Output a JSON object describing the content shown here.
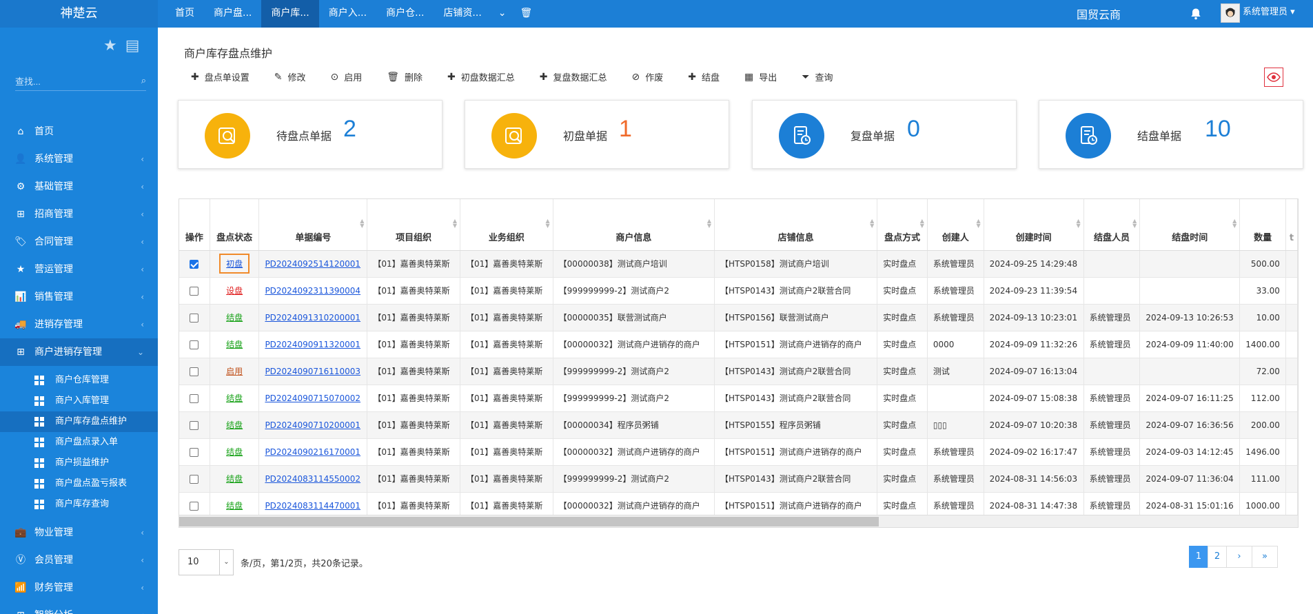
{
  "app": {
    "brand": "神楚云",
    "company": "国贸云商",
    "user": "系统管理员"
  },
  "topnav": [
    {
      "label": "首页",
      "active": false
    },
    {
      "label": "商户盘...",
      "active": false
    },
    {
      "label": "商户库...",
      "active": true
    },
    {
      "label": "商户入...",
      "active": false
    },
    {
      "label": "商户仓...",
      "active": false
    },
    {
      "label": "店铺资...",
      "active": false
    }
  ],
  "sidebar": {
    "search_placeholder": "查找...",
    "menu": [
      {
        "label": "首页",
        "icon": "home-icon",
        "glyph": "⌂",
        "chevron": ""
      },
      {
        "label": "系统管理",
        "icon": "user-icon",
        "glyph": "👤",
        "chevron": "‹"
      },
      {
        "label": "基础管理",
        "icon": "gear-icon",
        "glyph": "⚙",
        "chevron": "‹"
      },
      {
        "label": "招商管理",
        "icon": "windows-icon",
        "glyph": "⊞",
        "chevron": "‹"
      },
      {
        "label": "合同管理",
        "icon": "tag-icon",
        "glyph": "🏷",
        "chevron": "‹"
      },
      {
        "label": "营运管理",
        "icon": "star-icon",
        "glyph": "★",
        "chevron": "‹"
      },
      {
        "label": "销售管理",
        "icon": "bar-chart-icon",
        "glyph": "📊",
        "chevron": "‹"
      },
      {
        "label": "进销存管理",
        "icon": "truck-icon",
        "glyph": "🚚",
        "chevron": "‹"
      },
      {
        "label": "商户进销存管理",
        "icon": "windows-icon",
        "glyph": "⊞",
        "chevron": "⌄"
      }
    ],
    "submenu": [
      {
        "label": "商户仓库管理",
        "active": false
      },
      {
        "label": "商户入库管理",
        "active": false
      },
      {
        "label": "商户库存盘点维护",
        "active": true
      },
      {
        "label": "商户盘点录入单",
        "active": false
      },
      {
        "label": "商户损益维护",
        "active": false
      },
      {
        "label": "商户盘点盈亏报表",
        "active": false
      },
      {
        "label": "商户库存查询",
        "active": false
      }
    ],
    "menu_after": [
      {
        "label": "物业管理",
        "icon": "briefcase-icon",
        "glyph": "💼",
        "chevron": "‹"
      },
      {
        "label": "会员管理",
        "icon": "vip-icon",
        "glyph": "Ⓥ",
        "chevron": "‹"
      },
      {
        "label": "财务管理",
        "icon": "signal-icon",
        "glyph": "📶",
        "chevron": "‹"
      },
      {
        "label": "智能分析",
        "icon": "windows-icon",
        "glyph": "⊞",
        "chevron": "‹"
      }
    ]
  },
  "page": {
    "title": "商户库存盘点维护"
  },
  "toolbar": [
    {
      "label": "盘点单设置",
      "glyph": "✚",
      "icon": "plus-icon"
    },
    {
      "label": "修改",
      "glyph": "✎",
      "icon": "edit-icon"
    },
    {
      "label": "启用",
      "glyph": "⊙",
      "icon": "check-circle-icon"
    },
    {
      "label": "删除",
      "glyph": "🗑",
      "icon": "trash-icon"
    },
    {
      "label": "初盘数据汇总",
      "glyph": "✚",
      "icon": "plus-icon"
    },
    {
      "label": "复盘数据汇总",
      "glyph": "✚",
      "icon": "plus-icon"
    },
    {
      "label": "作废",
      "glyph": "⊘",
      "icon": "ban-icon"
    },
    {
      "label": "结盘",
      "glyph": "✚",
      "icon": "plus-icon"
    },
    {
      "label": "导出",
      "glyph": "▦",
      "icon": "table-icon"
    },
    {
      "label": "查询",
      "glyph": "⏷",
      "icon": "filter-icon"
    }
  ],
  "cards": [
    {
      "label": "待盘点单据",
      "value": "2",
      "color": "#f7b20c",
      "num_color": "#1c7fd6",
      "icon": "magnifier-doc-icon"
    },
    {
      "label": "初盘单据",
      "value": "1",
      "color": "#f7b20c",
      "num_color": "#f06a2a",
      "icon": "magnifier-doc-icon"
    },
    {
      "label": "复盘单据",
      "value": "0",
      "color": "#1c7fd6",
      "num_color": "#1c7fd6",
      "icon": "doc-clock-icon"
    },
    {
      "label": "结盘单据",
      "value": "10",
      "color": "#1c7fd6",
      "num_color": "#1c7fd6",
      "icon": "doc-clock-icon"
    }
  ],
  "table": {
    "headers": [
      "操作",
      "盘点状态",
      "单据编号",
      "项目组织",
      "业务组织",
      "商户信息",
      "店铺信息",
      "盘点方式",
      "创建人",
      "创建时间",
      "结盘人员",
      "结盘时间",
      "数量",
      "t"
    ],
    "rows": [
      {
        "checked": true,
        "status": "初盘",
        "status_type": "first",
        "code": "PD2024092514120001",
        "proj": "【01】嘉善奥特莱斯",
        "biz": "【01】嘉善奥特莱斯",
        "merchant": "【00000038】测试商户培训",
        "shop": "【HTSP0158】测试商户培训",
        "method": "实时盘点",
        "creator": "系统管理员",
        "created": "2024-09-25 14:29:48",
        "closer": "",
        "closed": "",
        "qty": "500.00"
      },
      {
        "checked": false,
        "status": "设盘",
        "status_type": "set",
        "code": "PD2024092311390004",
        "proj": "【01】嘉善奥特莱斯",
        "biz": "【01】嘉善奥特莱斯",
        "merchant": "【999999999-2】测试商户2",
        "shop": "【HTSP0143】测试商户2联营合同",
        "method": "实时盘点",
        "creator": "系统管理员",
        "created": "2024-09-23 11:39:54",
        "closer": "",
        "closed": "",
        "qty": "33.00"
      },
      {
        "checked": false,
        "status": "结盘",
        "status_type": "done",
        "code": "PD2024091310200001",
        "proj": "【01】嘉善奥特莱斯",
        "biz": "【01】嘉善奥特莱斯",
        "merchant": "【00000035】联营测试商户",
        "shop": "【HTSP0156】联营测试商户",
        "method": "实时盘点",
        "creator": "系统管理员",
        "created": "2024-09-13 10:23:01",
        "closer": "系统管理员",
        "closed": "2024-09-13 10:26:53",
        "qty": "10.00"
      },
      {
        "checked": false,
        "status": "结盘",
        "status_type": "done",
        "code": "PD2024090911320001",
        "proj": "【01】嘉善奥特莱斯",
        "biz": "【01】嘉善奥特莱斯",
        "merchant": "【00000032】测试商户进销存的商户",
        "shop": "【HTSP0151】测试商户进销存的商户",
        "method": "实时盘点",
        "creator": "0000",
        "created": "2024-09-09 11:32:26",
        "closer": "系统管理员",
        "closed": "2024-09-09 11:40:00",
        "qty": "1400.00"
      },
      {
        "checked": false,
        "status": "启用",
        "status_type": "on",
        "code": "PD2024090716110003",
        "proj": "【01】嘉善奥特莱斯",
        "biz": "【01】嘉善奥特莱斯",
        "merchant": "【999999999-2】测试商户2",
        "shop": "【HTSP0143】测试商户2联营合同",
        "method": "实时盘点",
        "creator": "测试",
        "created": "2024-09-07 16:13:04",
        "closer": "",
        "closed": "",
        "qty": "72.00"
      },
      {
        "checked": false,
        "status": "结盘",
        "status_type": "done",
        "code": "PD2024090715070002",
        "proj": "【01】嘉善奥特莱斯",
        "biz": "【01】嘉善奥特莱斯",
        "merchant": "【999999999-2】测试商户2",
        "shop": "【HTSP0143】测试商户2联营合同",
        "method": "实时盘点",
        "creator": "",
        "created": "2024-09-07 15:08:38",
        "closer": "系统管理员",
        "closed": "2024-09-07 16:11:25",
        "qty": "112.00"
      },
      {
        "checked": false,
        "status": "结盘",
        "status_type": "done",
        "code": "PD2024090710200001",
        "proj": "【01】嘉善奥特莱斯",
        "biz": "【01】嘉善奥特莱斯",
        "merchant": "【00000034】程序员粥铺",
        "shop": "【HTSP0155】程序员粥铺",
        "method": "实时盘点",
        "creator": "▯▯▯",
        "created": "2024-09-07 10:20:38",
        "closer": "系统管理员",
        "closed": "2024-09-07 16:36:56",
        "qty": "200.00"
      },
      {
        "checked": false,
        "status": "结盘",
        "status_type": "done",
        "code": "PD2024090216170001",
        "proj": "【01】嘉善奥特莱斯",
        "biz": "【01】嘉善奥特莱斯",
        "merchant": "【00000032】测试商户进销存的商户",
        "shop": "【HTSP0151】测试商户进销存的商户",
        "method": "实时盘点",
        "creator": "系统管理员",
        "created": "2024-09-02 16:17:47",
        "closer": "系统管理员",
        "closed": "2024-09-03 14:12:45",
        "qty": "1496.00"
      },
      {
        "checked": false,
        "status": "结盘",
        "status_type": "done",
        "code": "PD2024083114550002",
        "proj": "【01】嘉善奥特莱斯",
        "biz": "【01】嘉善奥特莱斯",
        "merchant": "【999999999-2】测试商户2",
        "shop": "【HTSP0143】测试商户2联营合同",
        "method": "实时盘点",
        "creator": "系统管理员",
        "created": "2024-08-31 14:56:03",
        "closer": "系统管理员",
        "closed": "2024-09-07 11:36:04",
        "qty": "111.00"
      },
      {
        "checked": false,
        "status": "结盘",
        "status_type": "done",
        "code": "PD2024083114470001",
        "proj": "【01】嘉善奥特莱斯",
        "biz": "【01】嘉善奥特莱斯",
        "merchant": "【00000032】测试商户进销存的商户",
        "shop": "【HTSP0151】测试商户进销存的商户",
        "method": "实时盘点",
        "creator": "系统管理员",
        "created": "2024-08-31 14:47:38",
        "closer": "系统管理员",
        "closed": "2024-08-31 15:01:16",
        "qty": "1000.00"
      }
    ]
  },
  "pagination": {
    "page_size": "10",
    "info": "条/页，第1/2页，共20条记录。",
    "pages": [
      "1",
      "2",
      "›",
      "»"
    ],
    "current": "1"
  }
}
